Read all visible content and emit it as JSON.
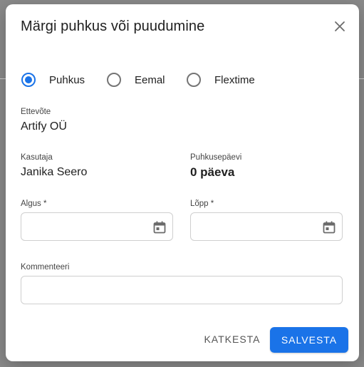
{
  "dialog": {
    "title": "Märgi puhkus või puudumine",
    "close_icon": "close-icon"
  },
  "type_options": [
    {
      "label": "Puhkus",
      "selected": true
    },
    {
      "label": "Eemal",
      "selected": false
    },
    {
      "label": "Flextime",
      "selected": false
    }
  ],
  "company": {
    "label": "Ettevõte",
    "value": "Artify OÜ"
  },
  "user": {
    "label": "Kasutaja",
    "value": "Janika Seero"
  },
  "vacation_days": {
    "label": "Puhkusepäevi",
    "value": "0 päeva"
  },
  "start": {
    "label": "Algus *",
    "value": "",
    "icon": "calendar-icon"
  },
  "end": {
    "label": "Lõpp *",
    "value": "",
    "icon": "calendar-icon"
  },
  "comment": {
    "label": "Kommenteeri",
    "value": ""
  },
  "actions": {
    "cancel": "KATKESTA",
    "save": "SALVESTA"
  },
  "colors": {
    "accent": "#1a73e8",
    "backdrop": "#8a8a8a"
  }
}
